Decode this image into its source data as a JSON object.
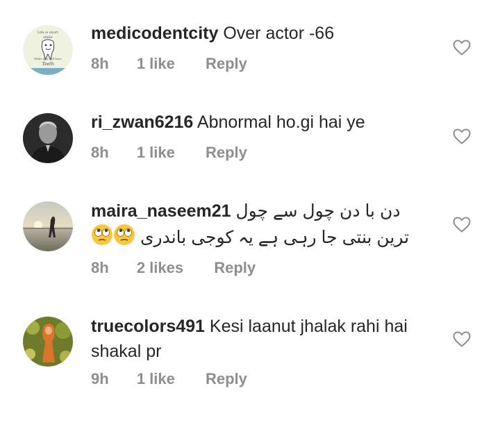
{
  "comments": [
    {
      "username": "medicodentcity",
      "text": "Over actor -66",
      "time": "8h",
      "likes": "1 like",
      "reply_label": "Reply",
      "avatar_icon": "tooth-cartoon-avatar",
      "avatar_lettering": [
        "Life is short",
        "smile",
        "While you still have",
        "Teeth"
      ]
    },
    {
      "username": "ri_zwan6216",
      "text": "Abnormal ho.gi hai ye",
      "time": "8h",
      "likes": "1 like",
      "reply_label": "Reply",
      "avatar_icon": "man-portrait-avatar"
    },
    {
      "username": "maira_naseem21",
      "text_line1": "دن با دن چول سے چول",
      "text_line2": "ترین بنتی جا رہی ہے یہ کوجی باندری",
      "emoji": "face-with-rolling-eyes",
      "emoji_count": 2,
      "time": "8h",
      "likes": "2 likes",
      "reply_label": "Reply",
      "avatar_icon": "sunset-beach-avatar"
    },
    {
      "username": "truecolors491",
      "text": "Kesi laanut jhalak rahi hai shakal pr",
      "time": "9h",
      "likes": "1 like",
      "reply_label": "Reply",
      "avatar_icon": "woman-field-avatar"
    }
  ],
  "colors": {
    "text": "#262626",
    "meta": "#8e8e8e",
    "heart_outline": "#8e8e8e",
    "background": "#ffffff"
  }
}
